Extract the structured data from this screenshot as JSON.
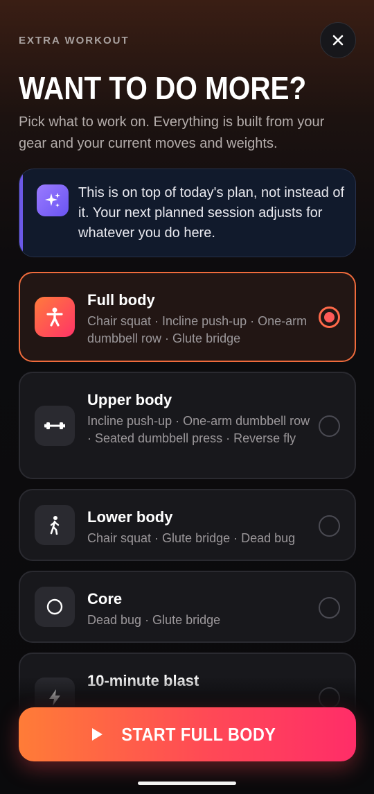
{
  "header": {
    "eyebrow": "EXTRA WORKOUT",
    "title": "WANT TO DO MORE?",
    "subtitle": "Pick what to work on. Everything is built from your gear and your current moves and weights."
  },
  "info": {
    "text": "This is on top of today's plan, not instead of it. Your next planned session adjusts for whatever you do here.",
    "icon": "sparkles-icon"
  },
  "options": [
    {
      "title": "Full body",
      "desc": "Chair squat · Incline push-up · One-arm dumbbell row · Glute bridge",
      "icon": "person-icon",
      "selected": true
    },
    {
      "title": "Upper body",
      "desc": "Incline push-up · One-arm dumbbell row · Seated dumbbell press · Reverse fly",
      "icon": "dumbbell-icon",
      "selected": false
    },
    {
      "title": "Lower body",
      "desc": "Chair squat · Glute bridge · Dead bug",
      "icon": "walking-icon",
      "selected": false
    },
    {
      "title": "Core",
      "desc": "Dead bug · Glute bridge",
      "icon": "circle-icon",
      "selected": false
    },
    {
      "title": "10-minute blast",
      "desc": "",
      "icon": "lightning-icon",
      "selected": false
    }
  ],
  "cta": {
    "label": "START FULL BODY",
    "icon": "play-icon"
  },
  "colors": {
    "accent": "#ff6a4a",
    "info_accent": "#6b59e8"
  }
}
